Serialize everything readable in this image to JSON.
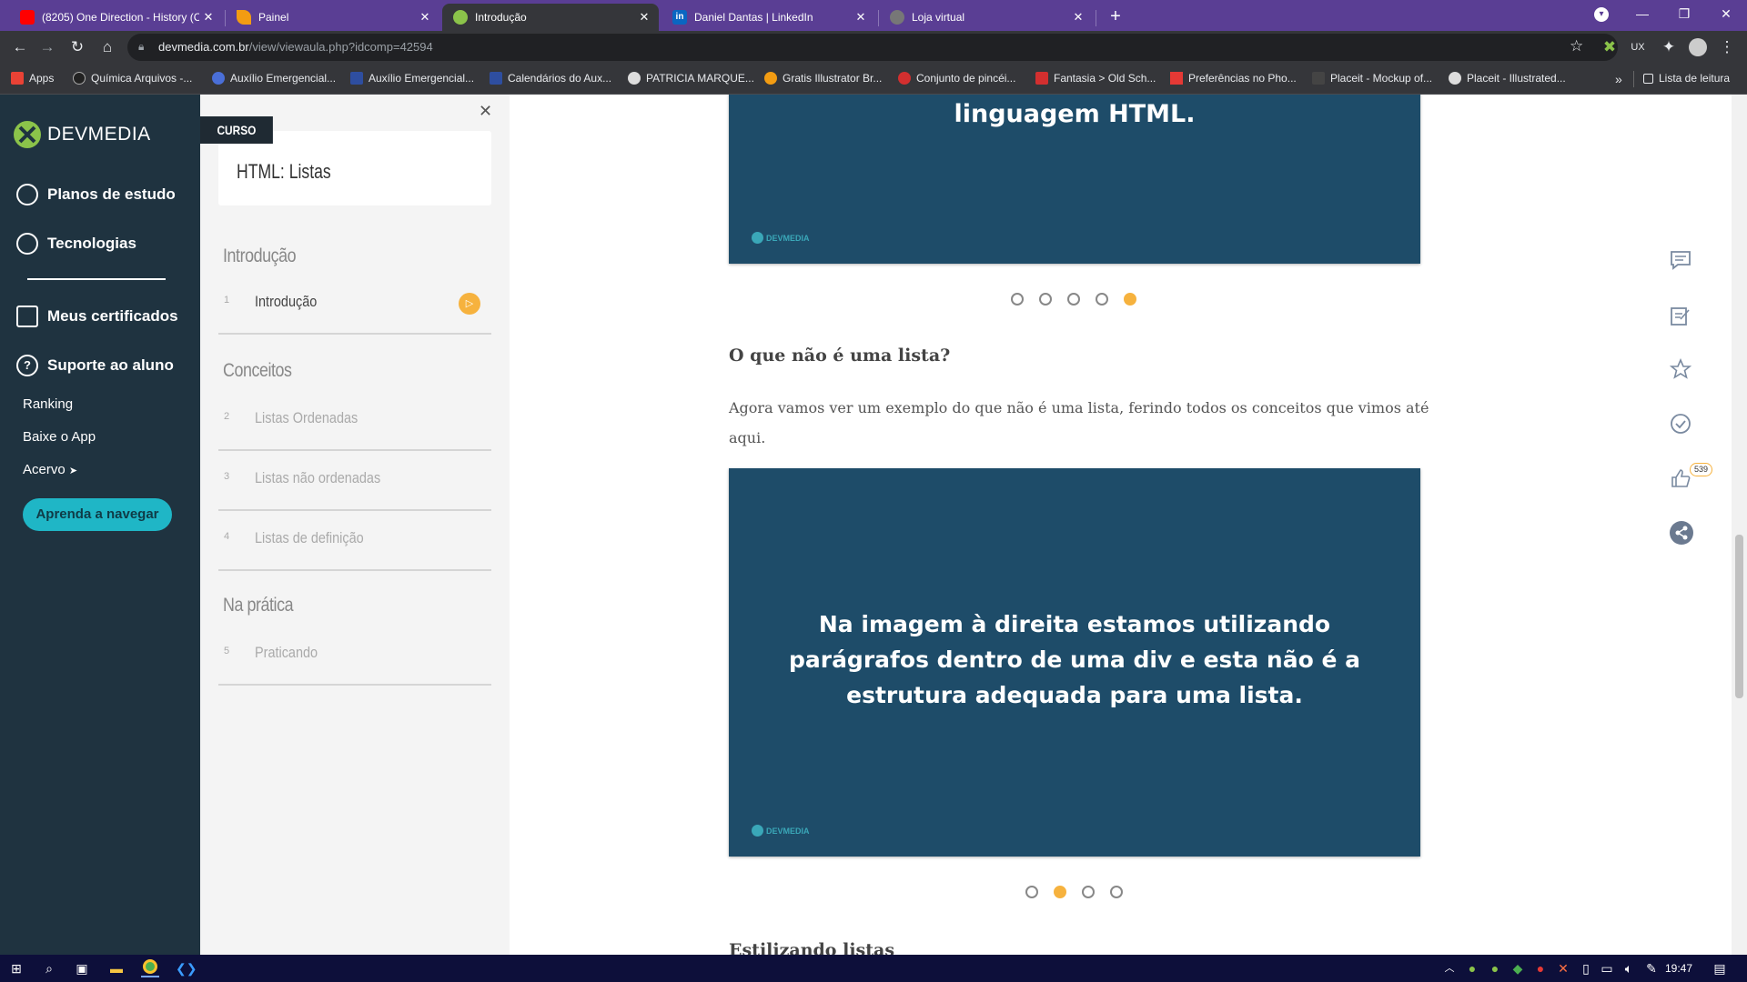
{
  "browser": {
    "tabs": [
      {
        "title": "(8205) One Direction - History (C",
        "favicon": "youtube-icon",
        "color": "#ff0000"
      },
      {
        "title": "Painel",
        "favicon": "painel-icon",
        "color": "#f39c12"
      },
      {
        "title": "Introdução",
        "favicon": "devmedia-icon",
        "color": "#8bc34a"
      },
      {
        "title": "Daniel Dantas | LinkedIn",
        "favicon": "linkedin-icon",
        "color": "#0a66c2"
      },
      {
        "title": "Loja virtual",
        "favicon": "globe-icon",
        "color": "#777777"
      }
    ],
    "url_domain": "devmedia.com.br",
    "url_path": "/view/viewaula.php?idcomp=42594",
    "bookmarks": [
      "Apps",
      "Química Arquivos -...",
      "Auxílio Emergencial...",
      "Auxílio Emergencial...",
      "Calendários do Aux...",
      "PATRICIA MARQUE...",
      "Gratis Illustrator Br...",
      "Conjunto de pincéi...",
      "Fantasia > Old Sch...",
      "Preferências no Pho...",
      "Placeit - Mockup of...",
      "Placeit - Illustrated..."
    ],
    "bookmark_more": "»",
    "reading_list": "Lista de leitura"
  },
  "sidebar": {
    "logo_text": "DEVMEDIA",
    "items": [
      {
        "label": "Planos de estudo",
        "icon": "chart-icon"
      },
      {
        "label": "Tecnologias",
        "icon": "compass-icon"
      },
      {
        "label": "Meus certificados",
        "icon": "certificate-icon"
      },
      {
        "label": "Suporte ao aluno",
        "icon": "help-icon"
      }
    ],
    "links": [
      "Ranking",
      "Baixe o App",
      "Acervo"
    ],
    "acervo_arrow": "➤",
    "cta": "Aprenda a navegar"
  },
  "course": {
    "badge": "CURSO",
    "title": "HTML: Listas",
    "close": "✕",
    "sections": [
      {
        "title": "Introdução",
        "lessons": [
          {
            "num": "1",
            "label": "Introdução",
            "active": true
          }
        ]
      },
      {
        "title": "Conceitos",
        "lessons": [
          {
            "num": "2",
            "label": "Listas Ordenadas"
          },
          {
            "num": "3",
            "label": "Listas não ordenadas"
          },
          {
            "num": "4",
            "label": "Listas de definição"
          }
        ]
      },
      {
        "title": "Na prática",
        "lessons": [
          {
            "num": "5",
            "label": "Praticando"
          }
        ]
      }
    ]
  },
  "content": {
    "slide1_text": "linguagem HTML.",
    "slide_logo": "DEVMEDIA",
    "carousel1": {
      "count": 5,
      "active": 4
    },
    "heading": "O que não é uma lista?",
    "paragraph": "Agora vamos ver um exemplo do que não é uma lista, ferindo todos os conceitos que vimos até aqui.",
    "slide2_text": "Na imagem à direita estamos utilizando parágrafos dentro de uma div e esta não é a estrutura adequada para uma lista.",
    "carousel2": {
      "count": 4,
      "active": 1
    },
    "next_heading": "Estilizando listas"
  },
  "actions": {
    "likes_count": "539",
    "icons": [
      "comment-icon",
      "notes-icon",
      "star-icon",
      "check-icon",
      "like-icon",
      "share-icon"
    ]
  },
  "taskbar": {
    "time": "19:47"
  },
  "colors": {
    "accent": "#f6b23e",
    "teal": "#1fb6c6",
    "slide_bg": "#1e4c69",
    "nav_bg": "#1f3340"
  }
}
